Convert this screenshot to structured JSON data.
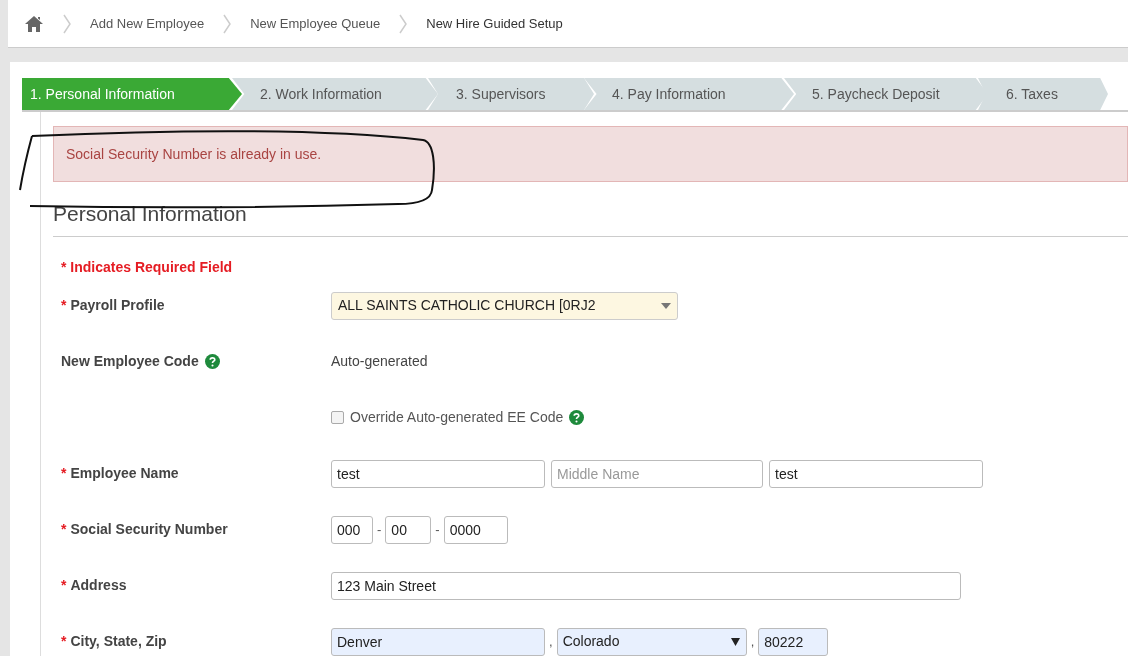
{
  "breadcrumb": [
    {
      "label": "Add New Employee",
      "current": false
    },
    {
      "label": "New Employee Queue",
      "current": false
    },
    {
      "label": "New Hire Guided Setup",
      "current": true
    }
  ],
  "steps": [
    {
      "label": "1. Personal Information",
      "selected": true
    },
    {
      "label": "2. Work Information",
      "selected": false
    },
    {
      "label": "3. Supervisors",
      "selected": false
    },
    {
      "label": "4. Pay Information",
      "selected": false
    },
    {
      "label": "5. Paycheck Deposit",
      "selected": false
    },
    {
      "label": "6. Taxes",
      "selected": false
    }
  ],
  "alert": {
    "message": "Social Security Number is already in use."
  },
  "section_title": "Personal Information",
  "required_note": "* Indicates Required Field",
  "rows": [
    {
      "kind": "select",
      "required_mark": "*",
      "label": "Payroll Profile",
      "value": "ALL SAINTS CATHOLIC CHURCH [0RJ2"
    },
    {
      "kind": "static",
      "label": "New Employee Code",
      "help": true,
      "value": "Auto-generated"
    },
    {
      "kind": "checkbox",
      "label": "Override Auto-generated EE Code",
      "checked": false,
      "help": true
    },
    {
      "kind": "name",
      "required_mark": "*",
      "label": "Employee Name",
      "inputs": [
        {
          "value": "test"
        },
        {
          "placeholder": "Middle Name"
        },
        {
          "value": "test"
        }
      ]
    },
    {
      "kind": "ssn",
      "required_mark": "*",
      "label": "Social Security Number",
      "inputs": [
        {
          "value": "000"
        },
        {
          "prefix": "-",
          "value": "00"
        },
        {
          "prefix": "-",
          "value": "0000"
        }
      ]
    },
    {
      "kind": "address",
      "required_mark": "*",
      "label": "Address",
      "inputs": [
        {
          "value": "123 Main Street"
        }
      ]
    },
    {
      "kind": "city",
      "required_mark": "*",
      "label": "City, State, Zip",
      "inputs": [
        {
          "value": "Denver",
          "autofilled": true
        },
        {
          "prefix": ",",
          "value": "Colorado",
          "autofilled": true,
          "dropdown": true
        },
        {
          "prefix": ",",
          "value": "80222",
          "autofilled": true
        }
      ]
    }
  ]
}
